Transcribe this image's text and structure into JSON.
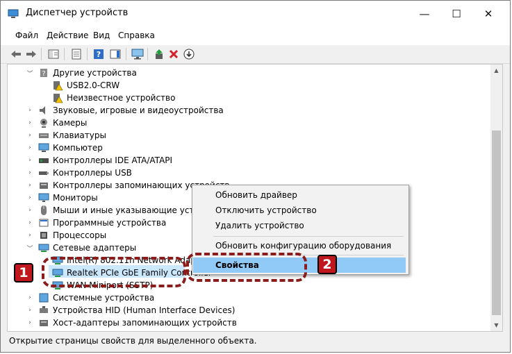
{
  "window": {
    "title": "Диспетчер устройств",
    "minimize": "—",
    "maximize": "☐",
    "close": "✕"
  },
  "menu": [
    "Файл",
    "Действие",
    "Вид",
    "Справка"
  ],
  "tree": {
    "other_devices": "Другие устройства",
    "usb": "USB2.0-CRW",
    "unknown": "Неизвестное устройство",
    "sound": "Звуковые, игровые и видеоустройства",
    "cameras": "Камеры",
    "keyboards": "Клавиатуры",
    "computer": "Компьютер",
    "ide": "Контроллеры IDE ATA/ATAPI",
    "usbctrl": "Контроллеры USB",
    "storage": "Контроллеры запоминающих устройств",
    "monitors": "Мониторы",
    "mice": "Мыши и иные указывающие устройства",
    "software": "Программные устройства",
    "cpu": "Процессоры",
    "net": "Сетевые адаптеры",
    "net_wifi": "Intel(R) 802.11n Network Adapter",
    "realtek": "Realtek PCIe GbE Family Controller",
    "wan": "WAN Miniport (SSTP)",
    "system": "Системные устройства",
    "hid": "Устройства HID (Human Interface Devices)",
    "host": "Хост-адаптеры запоминающих устройств"
  },
  "context_menu": {
    "update_driver": "Обновить драйвер",
    "disable": "Отключить устройство",
    "uninstall": "Удалить устройство",
    "scan": "Обновить конфигурацию оборудования",
    "properties": "Свойства"
  },
  "annotations": {
    "badge1": "1",
    "badge2": "2"
  },
  "status": "Открытие страницы свойств для выделенного объекта.",
  "colors": {
    "accent_highlight": "#91c9f7",
    "selection": "#cce8ff",
    "annotation_red": "#c0161d",
    "annotation_ring": "#8a1c1c"
  }
}
